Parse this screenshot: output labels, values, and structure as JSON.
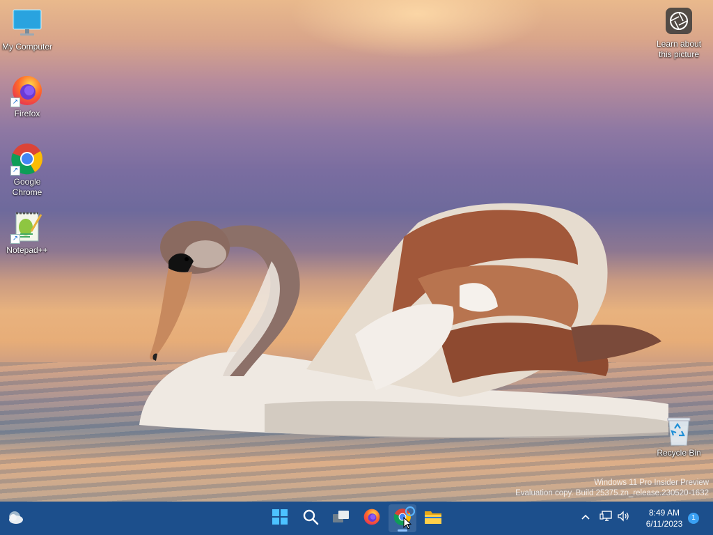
{
  "desktop_icons": [
    {
      "label": "My Computer",
      "icon": "monitor-icon",
      "shortcut": false
    },
    {
      "label": "Firefox",
      "icon": "firefox-icon",
      "shortcut": true
    },
    {
      "label": "Google Chrome",
      "icon": "chrome-icon",
      "shortcut": true
    },
    {
      "label": "Notepad++",
      "icon": "notepadpp-icon",
      "shortcut": true
    }
  ],
  "learn_about": {
    "label": "Learn about this picture",
    "icon": "camera-lens-icon"
  },
  "recycle_bin": {
    "label": "Recycle Bin",
    "icon": "recycle-bin-icon"
  },
  "watermark": {
    "line1": "Windows 11 Pro Insider Preview",
    "line2": "Evaluation copy. Build 25375.zn_release.230520-1632"
  },
  "taskbar": {
    "widgets": {
      "icon": "weather-cloud-icon"
    },
    "apps": [
      {
        "name": "Start",
        "icon": "windows-start-icon",
        "active": false
      },
      {
        "name": "Search",
        "icon": "search-icon",
        "active": false
      },
      {
        "name": "Task View",
        "icon": "task-view-icon",
        "active": false
      },
      {
        "name": "Firefox",
        "icon": "firefox-icon",
        "active": false
      },
      {
        "name": "Google Chrome",
        "icon": "chrome-icon",
        "active": true
      },
      {
        "name": "File Explorer",
        "icon": "folder-icon",
        "active": false
      }
    ],
    "tray": {
      "chevron": "chevron-up-icon",
      "network": "network-icon",
      "volume": "volume-icon"
    },
    "clock": {
      "time": "8:49 AM",
      "date": "6/11/2023"
    },
    "notification_count": "1",
    "colors": {
      "taskbar": "#1c4f8c",
      "accent": "#3aa0f3"
    }
  }
}
